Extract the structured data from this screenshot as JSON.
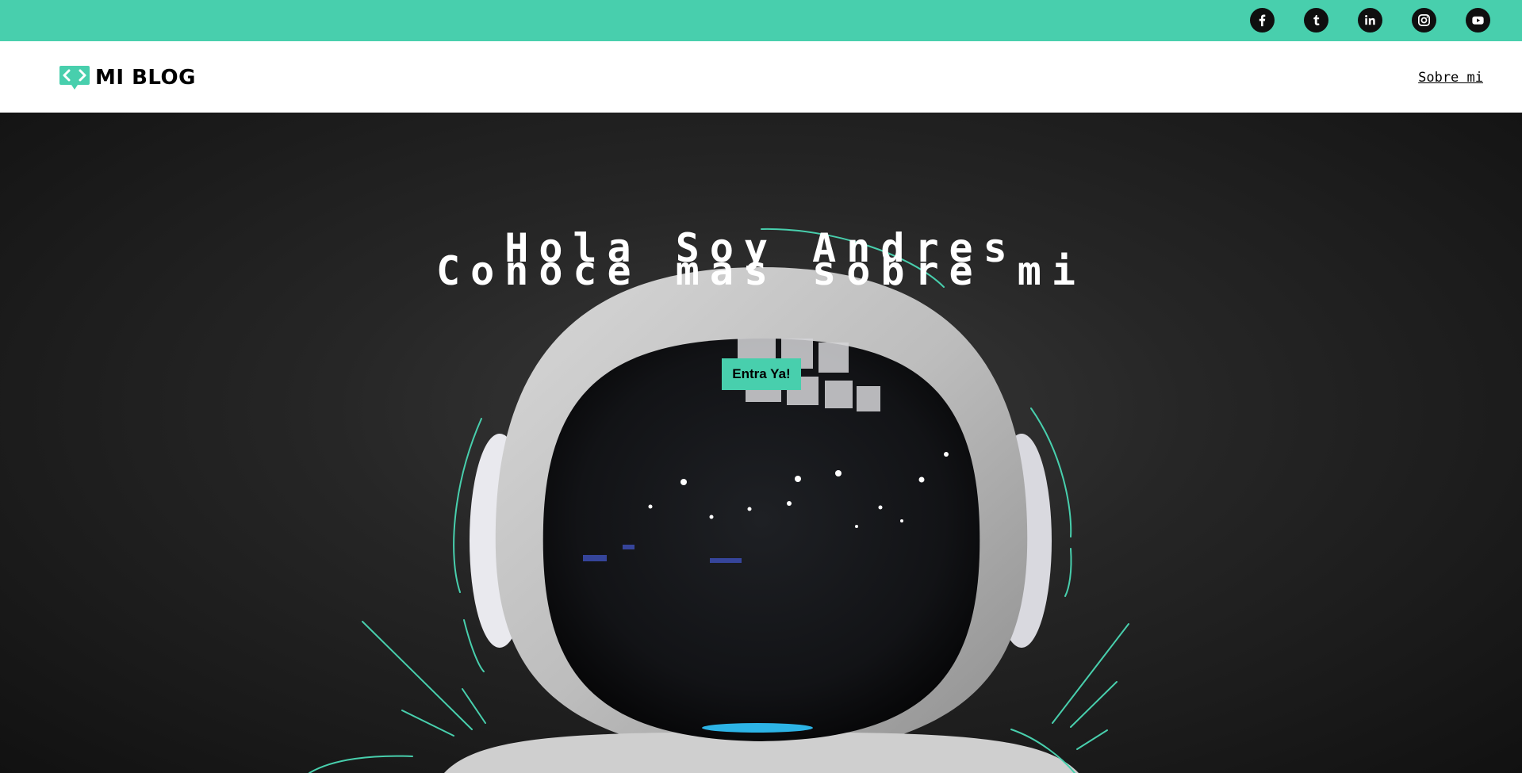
{
  "topbar": {
    "accent_color": "#48cfad",
    "socials": [
      {
        "icon": "facebook-icon"
      },
      {
        "icon": "tumblr-icon"
      },
      {
        "icon": "linkedin-icon"
      },
      {
        "icon": "instagram-icon"
      },
      {
        "icon": "youtube-icon"
      }
    ]
  },
  "navbar": {
    "logo_text": "MI BLOG",
    "links": [
      {
        "label": "Sobre mi"
      }
    ]
  },
  "hero": {
    "title": "Hola Soy Andres",
    "subtitle": "Conoce mas sobre mi",
    "cta_label": "Entra Ya!"
  }
}
